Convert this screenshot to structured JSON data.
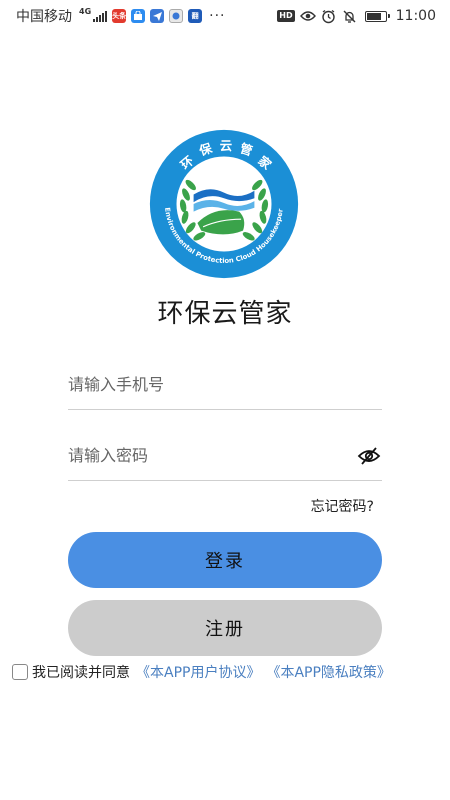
{
  "status_bar": {
    "carrier": "中国移动",
    "network": "4G",
    "app_badges": [
      {
        "label": "头条",
        "color": "#e23a2e",
        "icon": "news-app-icon"
      },
      {
        "label": "",
        "color": "#2d8cf0",
        "icon": "bag-app-icon"
      },
      {
        "label": "",
        "color": "#3a78d6",
        "icon": "telegram-app-icon"
      },
      {
        "label": "",
        "color": "#e8e8e8",
        "icon": "app-icon"
      },
      {
        "label": "翻",
        "color": "#1f5bb8",
        "icon": "translate-app-icon"
      }
    ],
    "more": "···",
    "hd": "HD",
    "battery_level": 0.8,
    "time": "11:00"
  },
  "app": {
    "title": "环保云管家",
    "logo_top_text": "环 保 云 管 家",
    "logo_ring_text": "Environmental Protection Cloud Housekeeper"
  },
  "form": {
    "phone_placeholder": "请输入手机号",
    "password_placeholder": "请输入密码",
    "forgot_label": "忘记密码?",
    "login_label": "登录",
    "register_label": "注册"
  },
  "agreement": {
    "prefix": "我已阅读并同意",
    "user_agreement": "《本APP用户协议》",
    "privacy_policy": "《本APP隐私政策》",
    "checked": false
  },
  "colors": {
    "primary": "#4a8fe3",
    "secondary_button": "#cccccc",
    "link": "#4a7fc0",
    "logo_blue": "#1b8fd6",
    "logo_green": "#3aa34a"
  }
}
